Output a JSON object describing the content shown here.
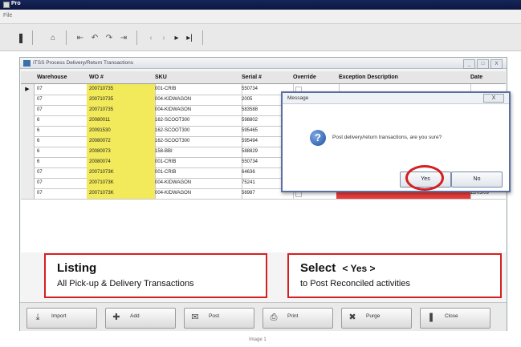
{
  "app": {
    "title": "Pro",
    "menu": "File"
  },
  "window": {
    "title": "ITSS Process Delivery/Return Transactions",
    "buttons": [
      "_",
      "□",
      "X"
    ]
  },
  "toolbar": {
    "icons": [
      "close-icon",
      "home-icon",
      "first-icon",
      "prev-icon",
      "next-icon",
      "last-icon",
      "nav-prev-icon",
      "nav-next-icon",
      "play-icon",
      "end-icon"
    ]
  },
  "grid": {
    "columns": [
      "Warehouse",
      "WO #",
      "SKU",
      "Serial #",
      "Override",
      "Exception Description",
      "Date"
    ],
    "rows": [
      {
        "marker": "▶",
        "warehouse": "07",
        "wo": "200710735",
        "sku": "001-CRIB",
        "serial": "550734",
        "override": "",
        "exception": "",
        "date": ""
      },
      {
        "marker": "",
        "warehouse": "07",
        "wo": "200710735",
        "sku": "004-KIDWAGON",
        "serial": "2005",
        "override": "",
        "exception": "",
        "date": ""
      },
      {
        "marker": "",
        "warehouse": "07",
        "wo": "200710735",
        "sku": "004-KIDWAGON",
        "serial": "583588",
        "override": "",
        "exception": "",
        "date": ""
      },
      {
        "marker": "",
        "warehouse": "6",
        "wo": "20080011",
        "sku": "162-SCOOT300",
        "serial": "598802",
        "override": "",
        "exception": "",
        "date": ""
      },
      {
        "marker": "",
        "warehouse": "6",
        "wo": "20091530",
        "sku": "162-SCOOT300",
        "serial": "595465",
        "override": "",
        "exception": "",
        "date": ""
      },
      {
        "marker": "",
        "warehouse": "6",
        "wo": "20080072",
        "sku": "162-SCOOT300",
        "serial": "595494",
        "override": "",
        "exception": "",
        "date": ""
      },
      {
        "marker": "",
        "warehouse": "6",
        "wo": "20080073",
        "sku": "158-BBI",
        "serial": "588829",
        "override": "",
        "exception": "",
        "date": ""
      },
      {
        "marker": "",
        "warehouse": "6",
        "wo": "20080074",
        "sku": "001-CRIB",
        "serial": "550734",
        "override": "",
        "exception": "",
        "date": "11/03/09"
      },
      {
        "marker": "",
        "warehouse": "07",
        "wo": "20071073K",
        "sku": "001-CRIB",
        "serial": "64636",
        "override": "",
        "exception": "",
        "date": "11/03/09"
      },
      {
        "marker": "",
        "warehouse": "07",
        "wo": "20071073K",
        "sku": "004-KIDWAGON",
        "serial": "75241",
        "override": "",
        "exception": "",
        "date": "11/03/09"
      },
      {
        "marker": "",
        "warehouse": "07",
        "wo": "20071073K",
        "sku": "004-KIDWAGON",
        "serial": "56987",
        "override": "",
        "exception": "",
        "date": "11/03/09"
      }
    ]
  },
  "callouts": {
    "listing_title": "Listing",
    "listing_sub": "All Pick-up & Delivery Transactions",
    "select_title": "Select",
    "select_yes": "< Yes >",
    "select_sub": "to Post Reconciled activities"
  },
  "dialog": {
    "title": "Message",
    "close": "X",
    "message": "Post delivery/return transactions, are you sure?",
    "yes": "Yes",
    "no": "No"
  },
  "actions": [
    {
      "name": "import",
      "label": "Import",
      "icon": "import-icon"
    },
    {
      "name": "add",
      "label": "Add",
      "icon": "add-icon"
    },
    {
      "name": "post",
      "label": "Post",
      "icon": "post-icon"
    },
    {
      "name": "print",
      "label": "Print",
      "icon": "print-icon"
    },
    {
      "name": "purge",
      "label": "Purge",
      "icon": "purge-icon"
    },
    {
      "name": "close",
      "label": "Close",
      "icon": "close-book-icon"
    }
  ],
  "caption": "Image 1",
  "colors": {
    "highlight_yellow": "#f2ea5a",
    "exception_red": "#e83a3a",
    "callout_red": "#d42020",
    "titlebar": "#16265a"
  }
}
